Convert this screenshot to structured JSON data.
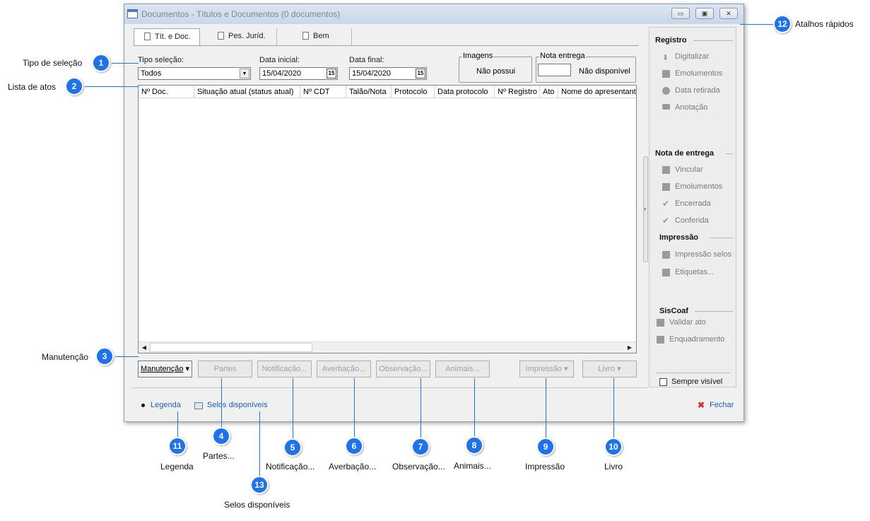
{
  "window": {
    "title": "Documentos - Títulos e Documentos (0 documentos)",
    "min": "▭",
    "max": "▣",
    "close": "✕"
  },
  "tabs": [
    {
      "label": "Tít. e Doc."
    },
    {
      "label": "Pes. Juríd."
    },
    {
      "label": "Bem"
    }
  ],
  "filters": {
    "tipo_label": "Tipo seleção:",
    "tipo_value": "Todos",
    "data_inicial_label": "Data inicial:",
    "data_inicial_value": "15/04/2020",
    "data_final_label": "Data final:",
    "data_final_value": "15/04/2020",
    "cal_glyph": "15",
    "imagens_label": "Imagens",
    "imagens_value": "Não possui",
    "nota_label": "Nota entrega",
    "nota_value": "Não disponível"
  },
  "grid": {
    "columns": [
      "Nº Doc.",
      "Situação atual (status atual)",
      "Nº CDT",
      "Talão/Nota",
      "Protocolo",
      "Data protocolo",
      "Nº Registro",
      "Ato",
      "Nome do apresentante"
    ]
  },
  "buttons": {
    "manutencao": "Manutenção",
    "partes": "Partes",
    "notificacao": "Notificação...",
    "averbacao": "Averbação...",
    "observacao": "Observação...",
    "animais": "Animais...",
    "impressao": "Impressão",
    "livro": "Livro"
  },
  "footer": {
    "legenda": "Legenda",
    "selos": "Selos disponíveis",
    "fechar": "Fechar"
  },
  "side": {
    "registro": "Registro",
    "digitalizar": "Digitalizar",
    "emolumentos": "Emolumentos",
    "data_retirada": "Data retirada",
    "anotacao": "Anotação",
    "nota_entrega": "Nota de entrega",
    "vincular": "Vincular",
    "emolumentos2": "Emolumentos",
    "encerrada": "Encerrada",
    "conferida": "Conferida",
    "impressao": "Impressão",
    "impressao_selos": "Impressão selos",
    "etiquetas": "Etiquetas...",
    "siscoaf": "SisCoaf",
    "validar_ato": "Validar ato",
    "enquadramento": "Enquadramento",
    "sempre_visivel": "Sempre visível"
  },
  "annotations": [
    {
      "num": "1",
      "label": "Tipo de seleção"
    },
    {
      "num": "2",
      "label": "Lista de atos"
    },
    {
      "num": "3",
      "label": "Manutenção"
    },
    {
      "num": "4",
      "label": "Partes..."
    },
    {
      "num": "5",
      "label": "Notificação..."
    },
    {
      "num": "6",
      "label": "Averbação..."
    },
    {
      "num": "7",
      "label": "Observação..."
    },
    {
      "num": "8",
      "label": "Animais..."
    },
    {
      "num": "9",
      "label": "Impressão"
    },
    {
      "num": "10",
      "label": "Livro"
    },
    {
      "num": "11",
      "label": "Legenda"
    },
    {
      "num": "12",
      "label": "Atalhos rápidos"
    },
    {
      "num": "13",
      "label": "Selos disponíveis"
    }
  ],
  "colors": {
    "badge": "#1e73e8",
    "link": "#1e5db8",
    "close_icon": "#d93030"
  }
}
